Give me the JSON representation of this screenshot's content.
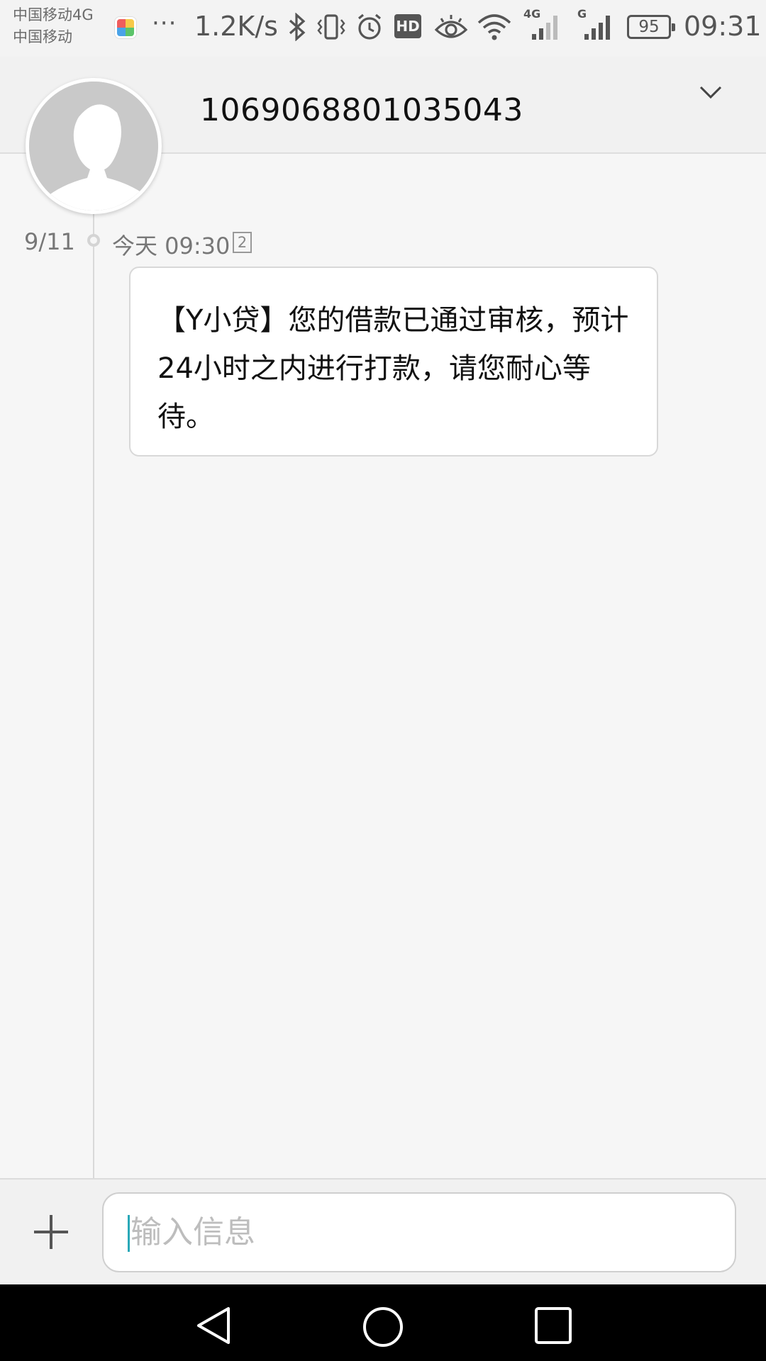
{
  "status_bar": {
    "carrier_primary": "中国移动4G",
    "carrier_secondary": "中国移动",
    "more": "···",
    "speed": "1.2K/s",
    "hd_badge": "HD",
    "net_4g": "4G",
    "net_g": "G",
    "battery_level": "95",
    "time": "09:31",
    "icons": [
      "app-icon",
      "bluetooth-icon",
      "vibrate-icon",
      "alarm-icon",
      "hd-icon",
      "eye-icon",
      "wifi-icon",
      "signal-4g-icon",
      "signal-g-icon",
      "battery-icon"
    ]
  },
  "header": {
    "contact_number": "1069068801035043",
    "expand_icon": "chevron-down-icon"
  },
  "thread": {
    "date": "9/11",
    "messages": [
      {
        "time": "今天 09:30",
        "sim": "2",
        "text": "【Y小贷】您的借款已通过审核，预计24小时之内进行打款，请您耐心等待。"
      }
    ]
  },
  "composer": {
    "add_icon": "plus-icon",
    "placeholder": "输入信息"
  },
  "nav_bar": {
    "icons": [
      "back-icon",
      "home-icon",
      "recents-icon"
    ]
  },
  "colors": {
    "background": "#f6f6f6",
    "header": "#f1f1f1",
    "caret": "#29a8b8",
    "nav": "#000000"
  }
}
